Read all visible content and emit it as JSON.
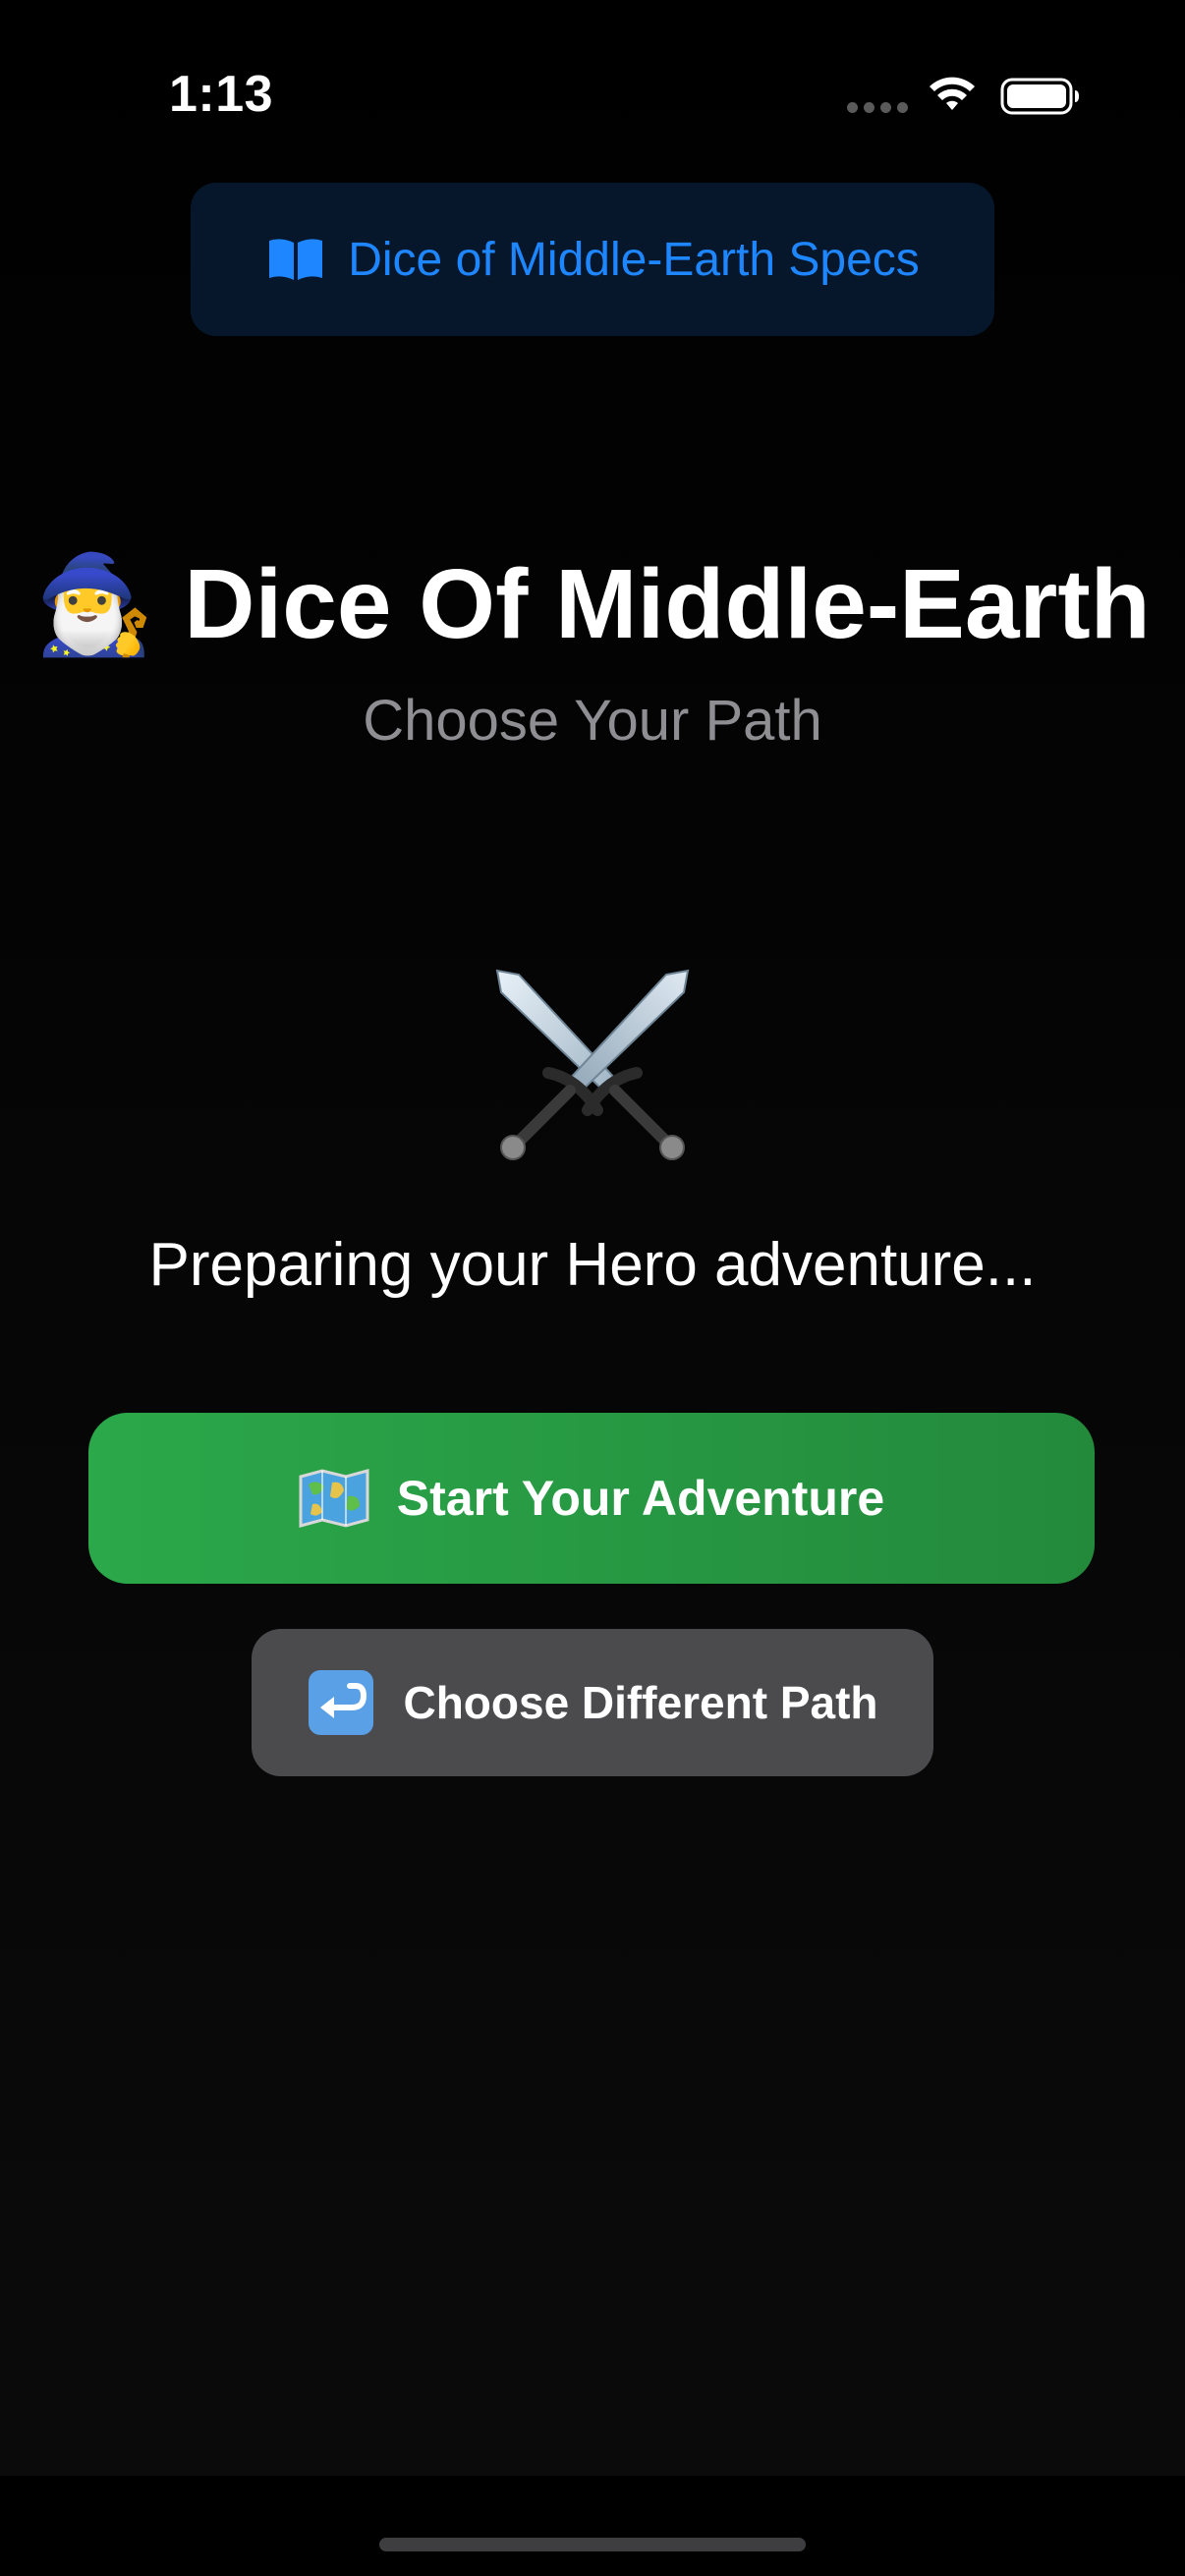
{
  "status_bar": {
    "time": "1:13",
    "icons": [
      "cellular-dots-icon",
      "wifi-icon",
      "battery-icon"
    ]
  },
  "specs_button": {
    "icon": "open-book-icon",
    "label": "Dice of Middle-Earth Specs",
    "color": "#1e86ff"
  },
  "header": {
    "icon": "🧙‍♂️",
    "title": "Dice Of Middle-Earth",
    "subtitle": "Choose Your Path"
  },
  "hero": {
    "icon": "crossed-swords-icon",
    "status_message": "Preparing your Hero adventure..."
  },
  "actions": {
    "start": {
      "icon": "world-map-icon",
      "label": "Start Your Adventure",
      "color": "#2ba84a"
    },
    "back": {
      "icon": "return-arrow-icon",
      "label": "Choose Different Path",
      "color": "#4b4b4e"
    }
  }
}
